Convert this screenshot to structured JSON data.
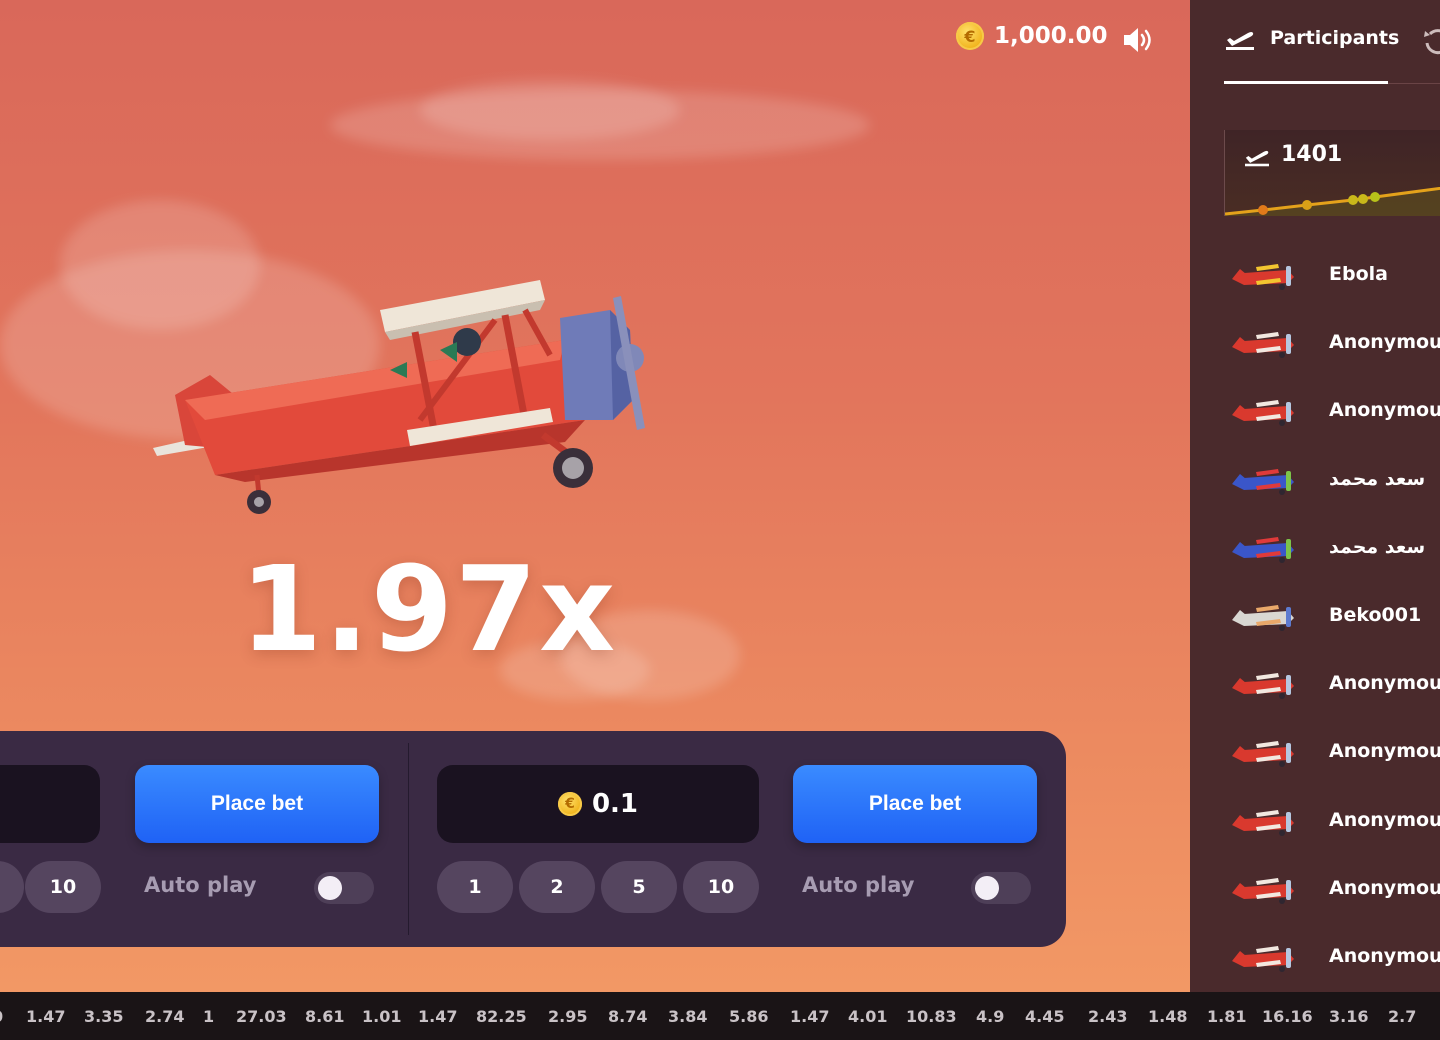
{
  "header": {
    "balance": "1,000.00",
    "coin_symbol": "€"
  },
  "game": {
    "multiplier": "1.97x"
  },
  "bet_panels": [
    {
      "chips": [
        "10"
      ],
      "place_bet_label": "Place bet",
      "autoplay_label": "Auto play",
      "autoplay_on": false
    },
    {
      "amount": "0.1",
      "chips": [
        "1",
        "2",
        "5",
        "10"
      ],
      "place_bet_label": "Place bet",
      "autoplay_label": "Auto play",
      "autoplay_on": false
    }
  ],
  "sidebar": {
    "tab_label": "Participants",
    "flight_count": "1401",
    "participants": [
      {
        "name": "Ebola",
        "plane": "red-biplane-yellow"
      },
      {
        "name": "Anonymous",
        "plane": "red-biplane"
      },
      {
        "name": "Anonymous",
        "plane": "red-biplane"
      },
      {
        "name": "سعد محمد",
        "plane": "blue-red-plane"
      },
      {
        "name": "سعد محمد",
        "plane": "blue-red-plane"
      },
      {
        "name": "Beko001",
        "plane": "silver-plane"
      },
      {
        "name": "Anonymous",
        "plane": "red-biplane"
      },
      {
        "name": "Anonymous",
        "plane": "red-biplane"
      },
      {
        "name": "Anonymous",
        "plane": "red-biplane"
      },
      {
        "name": "Anonymous",
        "plane": "red-biplane"
      },
      {
        "name": "Anonymous",
        "plane": "red-biplane"
      }
    ]
  },
  "ticker": {
    "values": [
      "1.47",
      "3.35",
      "2.74",
      "1",
      "27.03",
      "8.61",
      "1.01",
      "1.47",
      "82.25",
      "2.95",
      "8.74",
      "3.84",
      "5.86",
      "1.47",
      "4.01",
      "10.83",
      "4.9",
      "4.45",
      "2.43",
      "1.48",
      "1.81",
      "16.16",
      "3.16",
      "2.7"
    ]
  },
  "colors": {
    "accent_button": "#2f7bff",
    "panel_bg": "#3a2a44",
    "sidebar_bg": "#4a2a2c"
  }
}
